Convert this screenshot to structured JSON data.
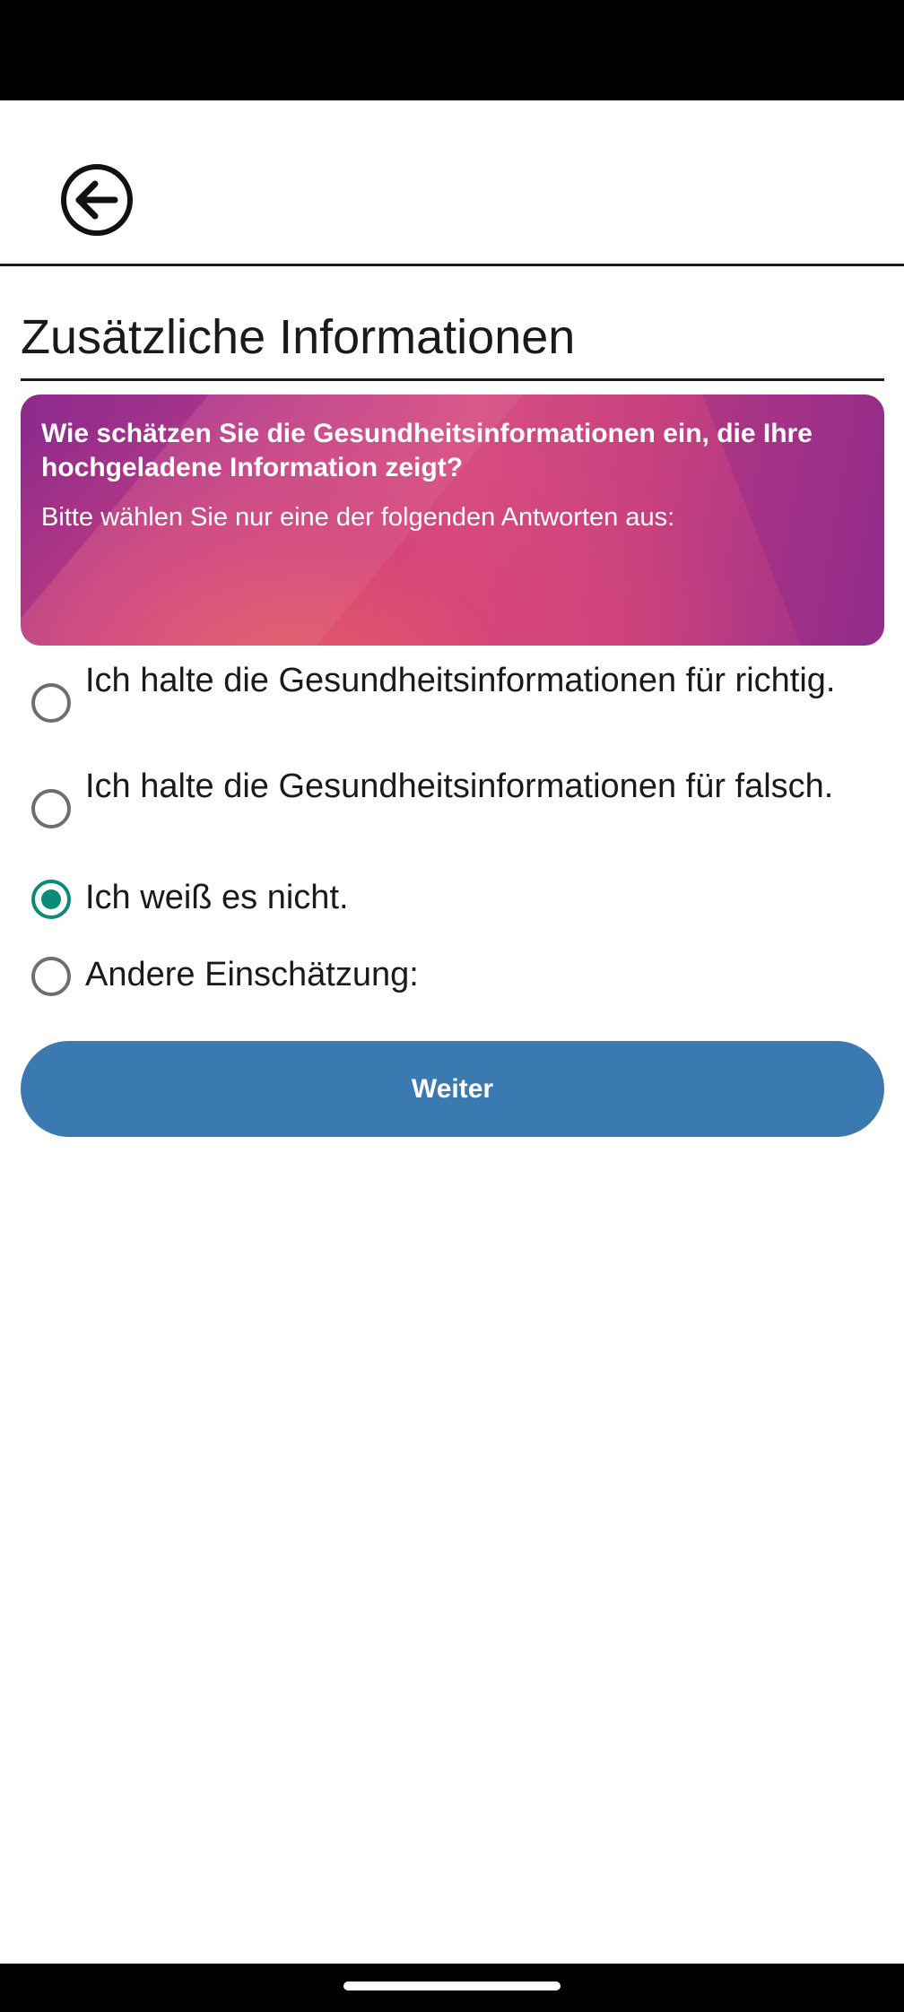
{
  "header": {
    "back_icon": "arrow-left-circle-icon"
  },
  "page": {
    "title": "Zusätzliche Informationen"
  },
  "banner": {
    "question": "Wie schätzen Sie die Gesundheitsinformationen ein, die Ihre hochgeladene Information zeigt?",
    "instruction": "Bitte wählen Sie nur eine der folgenden Antworten aus:",
    "colors": {
      "purple": "#8f2c8c",
      "magenta": "#c6407f",
      "coral": "#e65a64"
    }
  },
  "options": [
    {
      "label": "Ich halte die Gesundheitsinformationen für richtig.",
      "selected": false
    },
    {
      "label": "Ich halte die Gesundheitsinformationen für falsch.",
      "selected": false
    },
    {
      "label": "Ich weiß es nicht.",
      "selected": true
    },
    {
      "label": "Andere Einschätzung:",
      "selected": false
    }
  ],
  "actions": {
    "next_label": "Weiter"
  },
  "colors": {
    "accent_radio": "#0a8a78",
    "button_bg": "#3a7ab1"
  }
}
